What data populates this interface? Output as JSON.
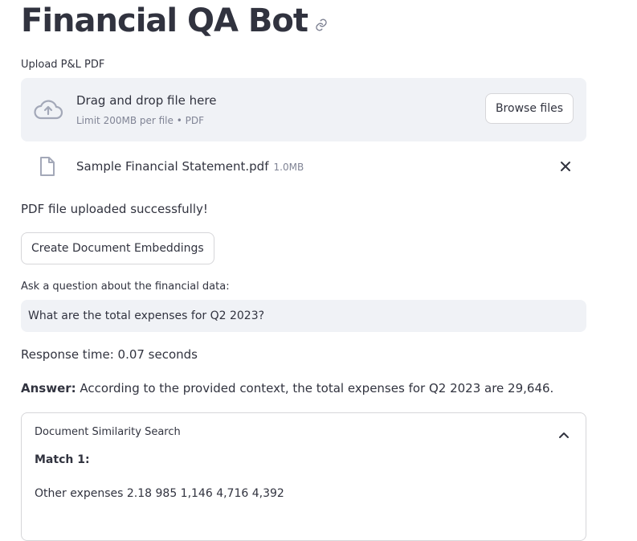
{
  "header": {
    "title": "Financial QA Bot",
    "link_icon": "link-icon"
  },
  "uploader": {
    "label": "Upload P&L PDF",
    "drop_text": "Drag and drop file here",
    "limit_text": "Limit 200MB per file • PDF",
    "browse_label": "Browse files",
    "icon": "cloud-upload-icon"
  },
  "uploaded_file": {
    "name": "Sample Financial Statement.pdf",
    "size": "1.0MB",
    "icon": "file-icon",
    "remove_icon": "close-icon"
  },
  "status": {
    "success_text": "PDF file uploaded successfully!"
  },
  "actions": {
    "embed_label": "Create Document Embeddings"
  },
  "question": {
    "label": "Ask a question about the financial data:",
    "value": "What are the total expenses for Q2 2023?"
  },
  "response": {
    "time_text": "Response time: 0.07 seconds",
    "answer_label": "Answer:",
    "answer_text": " According to the provided context, the total expenses for Q2 2023 are 29,646."
  },
  "similarity": {
    "title": "Document Similarity Search",
    "expanded": true,
    "matches": [
      {
        "label": "Match 1:",
        "text": "Other expenses 2.18 985 1,146 4,716 4,392"
      }
    ]
  },
  "colors": {
    "text": "#31333f",
    "muted": "#808495",
    "input_bg": "#f0f2f6",
    "border": "#d6d6d9"
  }
}
